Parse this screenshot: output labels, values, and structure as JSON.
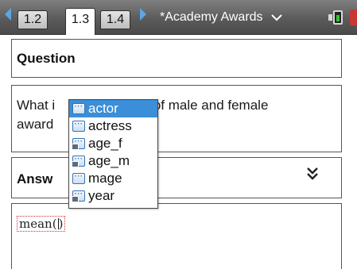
{
  "tabbar": {
    "tabs": [
      {
        "label": "1.2",
        "active": false
      },
      {
        "label": "1.3",
        "active": true
      },
      {
        "label": "1.4",
        "active": false
      }
    ],
    "document_title": "*Academy Awards",
    "accent_color": "#5aa6e6"
  },
  "question": {
    "heading": "Question",
    "text_visible_left": "What i",
    "text_visible_right": "ge of male and female",
    "text_line2": "award"
  },
  "answer": {
    "heading": "Answ"
  },
  "entry": {
    "text": "mean("
  },
  "autocomplete": {
    "selected_color": "#3b8ed8",
    "items": [
      {
        "label": "actor",
        "icon": "list-variable-icon",
        "selected": true
      },
      {
        "label": "actress",
        "icon": "list-variable-icon",
        "selected": false
      },
      {
        "label": "age_f",
        "icon": "locked-variable-icon",
        "selected": false
      },
      {
        "label": "age_m",
        "icon": "locked-variable-icon",
        "selected": false
      },
      {
        "label": "mage",
        "icon": "list-variable-icon",
        "selected": false
      },
      {
        "label": "year",
        "icon": "locked-variable-icon",
        "selected": false
      }
    ]
  }
}
